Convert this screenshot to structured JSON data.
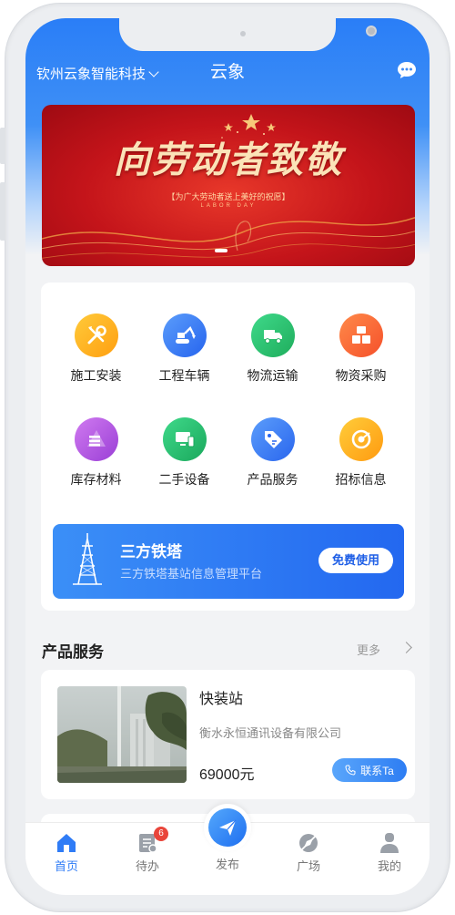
{
  "header": {
    "company": "钦州云象智能科技",
    "app_title": "云象"
  },
  "banner": {
    "title": "向劳动者致敬",
    "subtitle": "【为广大劳动者送上美好的祝愿】",
    "english": "LABOR DAY"
  },
  "categories": [
    {
      "label": "施工安装",
      "icon": "wrench-screwdriver-icon",
      "color": "#ffb020"
    },
    {
      "label": "工程车辆",
      "icon": "excavator-icon",
      "color": "#3b82f6"
    },
    {
      "label": "物流运输",
      "icon": "truck-icon",
      "color": "#22c06a"
    },
    {
      "label": "物资采购",
      "icon": "boxes-icon",
      "color": "#ff6a3a"
    },
    {
      "label": "库存材料",
      "icon": "stack-icon",
      "color": "#b657e0"
    },
    {
      "label": "二手设备",
      "icon": "devices-icon",
      "color": "#24c07a"
    },
    {
      "label": "产品服务",
      "icon": "tag-icon",
      "color": "#3f86f8"
    },
    {
      "label": "招标信息",
      "icon": "target-icon",
      "color": "#ffb21a"
    }
  ],
  "tower_promo": {
    "title": "三方铁塔",
    "subtitle": "三方铁塔基站信息管理平台",
    "button": "免费使用"
  },
  "section": {
    "title": "产品服务",
    "more": "更多"
  },
  "product": {
    "name": "快装站",
    "company": "衡水永恒通讯设备有限公司",
    "price": "69000元",
    "contact": "联系Ta"
  },
  "tabbar": {
    "home": "首页",
    "todo": "待办",
    "todo_badge": "6",
    "publish": "发布",
    "plaza": "广场",
    "mine": "我的"
  },
  "colors": {
    "primary": "#2f7cf6",
    "banner_red": "#c4141a",
    "badge_red": "#e9453a"
  }
}
